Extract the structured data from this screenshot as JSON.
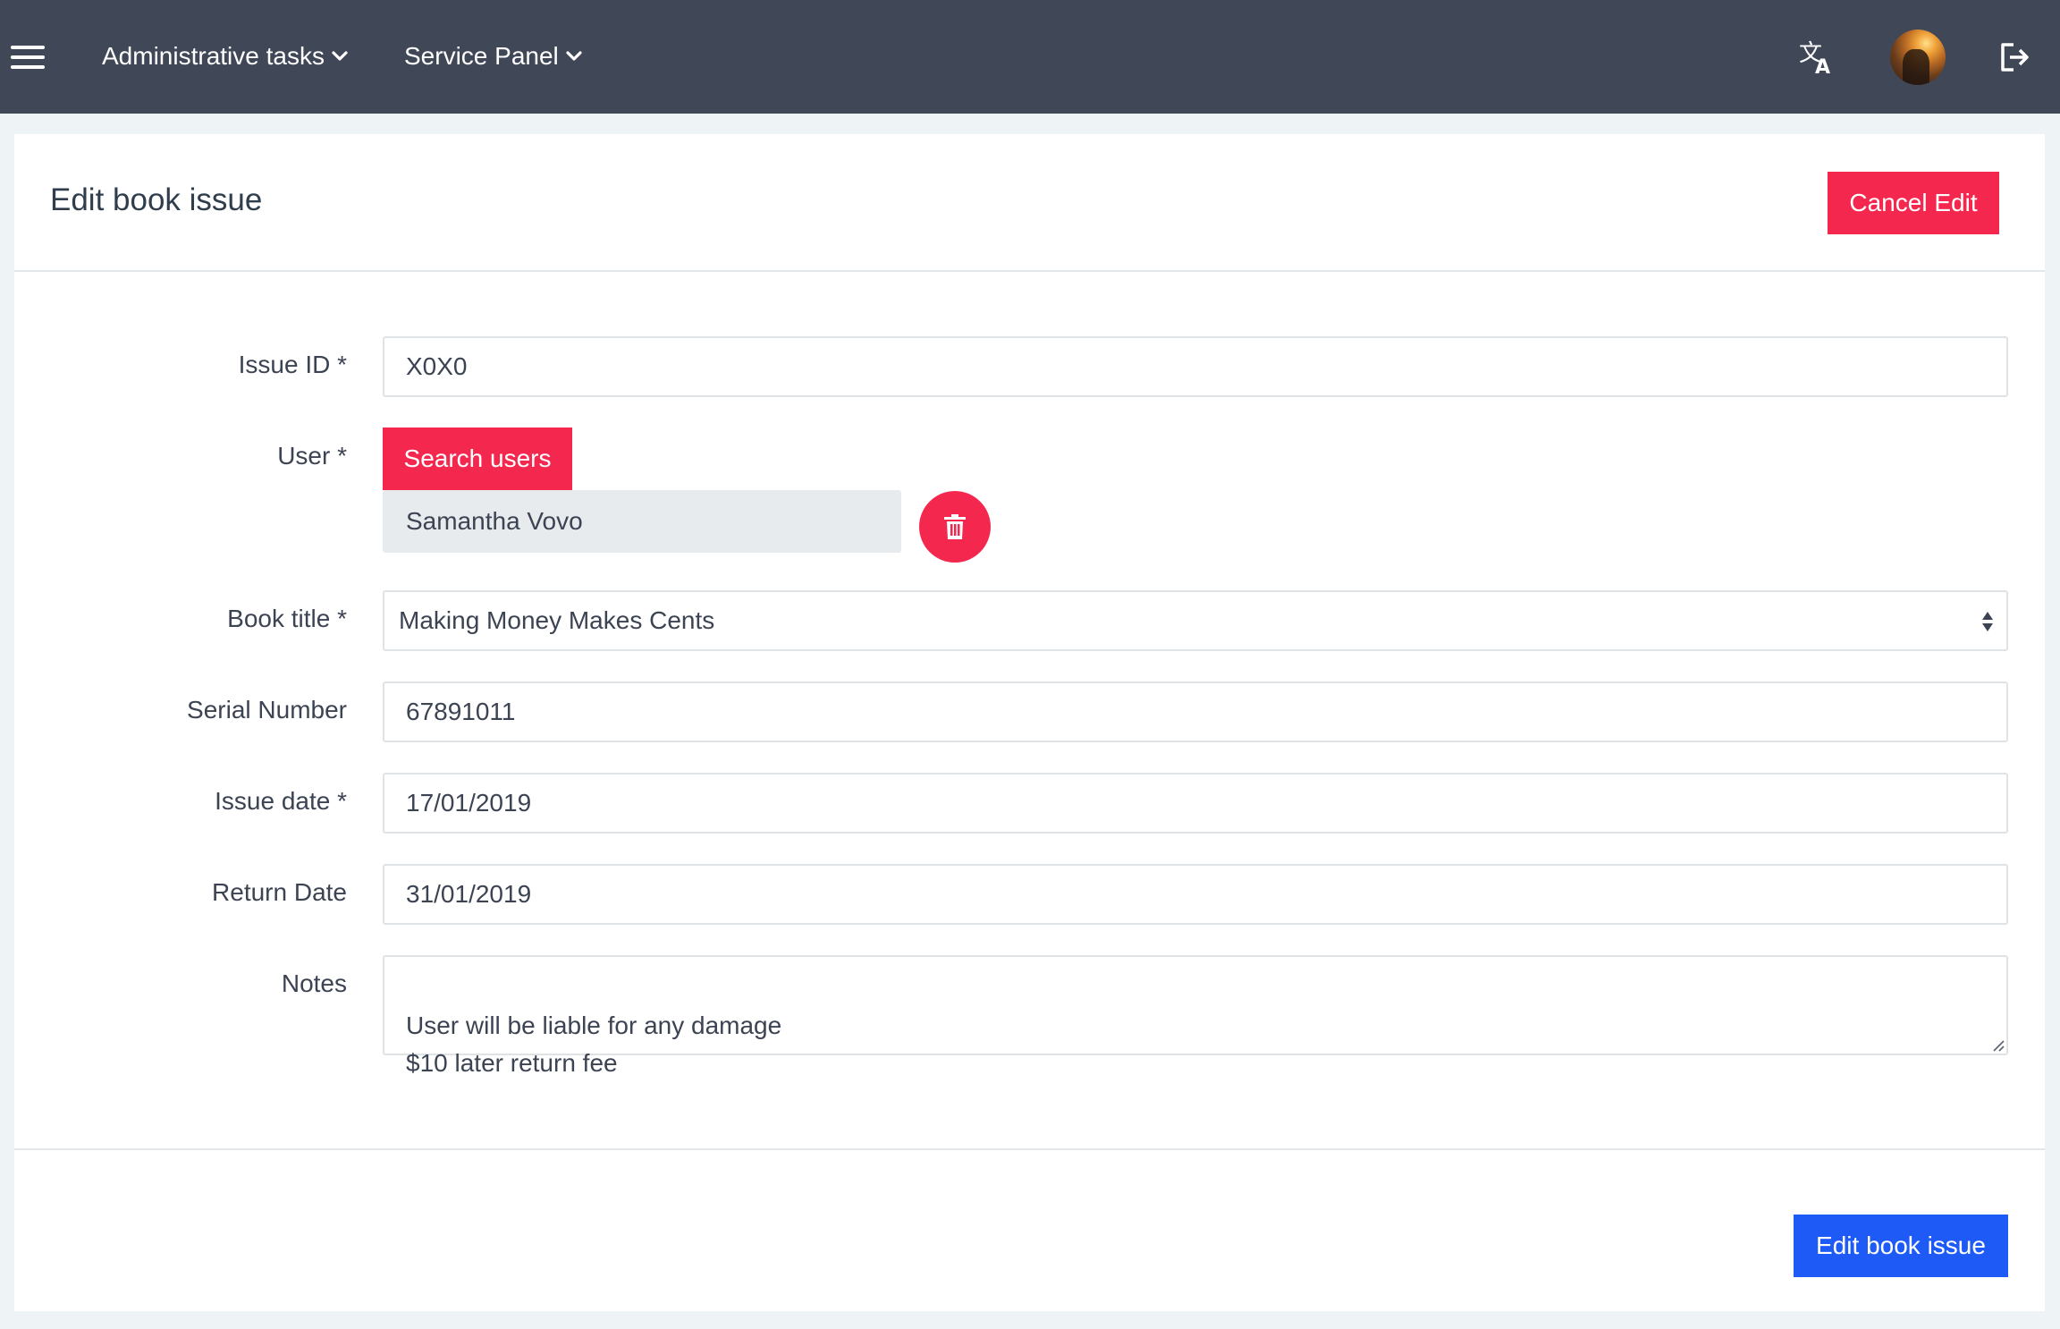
{
  "nav": {
    "menu_icon": "hamburger-icon",
    "administrative_tasks": "Administrative tasks",
    "service_panel": "Service Panel",
    "translate_icon": "translate-icon",
    "logout_icon": "logout-icon"
  },
  "card": {
    "title": "Edit book issue",
    "cancel_label": "Cancel Edit",
    "submit_label": "Edit book issue"
  },
  "form": {
    "issue_id": {
      "label": "Issue ID *",
      "value": "X0X0"
    },
    "user": {
      "label": "User *",
      "search_label": "Search users",
      "selected": "Samantha Vovo",
      "delete_icon": "trash-icon"
    },
    "book_title": {
      "label": "Book title *",
      "value": "Making Money Makes Cents"
    },
    "serial_number": {
      "label": "Serial Number",
      "value": "67891011"
    },
    "issue_date": {
      "label": "Issue date *",
      "value": "17/01/2019"
    },
    "return_date": {
      "label": "Return Date",
      "value": "31/01/2019"
    },
    "notes": {
      "label": "Notes",
      "value": "User will be liable for any damage\n$10 later return fee"
    }
  },
  "colors": {
    "navbar": "#404757",
    "danger": "#f4284f",
    "primary": "#1e5bf6",
    "page_background": "#eef3f6"
  }
}
